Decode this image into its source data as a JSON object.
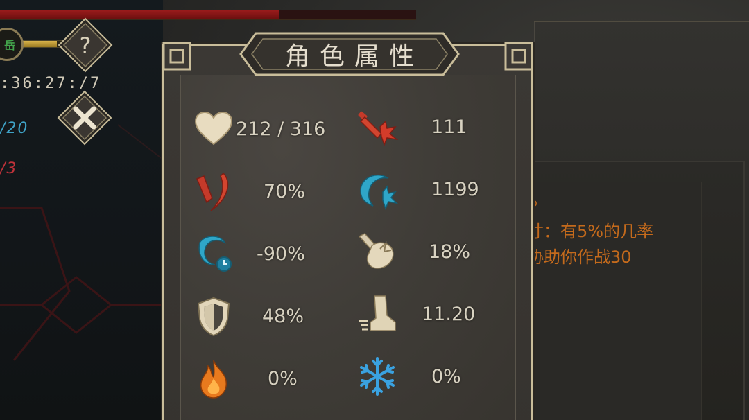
{
  "hud": {
    "hp_fraction": 0.67,
    "xp_fraction": 0.8,
    "level_text": "岳",
    "timer": ":36:27:/7",
    "counter_blue": "/20",
    "counter_red": "/3",
    "help_icon": "question-icon",
    "close_icon": "close-x-icon"
  },
  "panel": {
    "title": "角色属性",
    "stats": [
      {
        "icon": "heart-icon",
        "value": "212 / 316"
      },
      {
        "icon": "attack-icon",
        "value": "111"
      },
      {
        "icon": "crit-chance-icon",
        "value": "70%"
      },
      {
        "icon": "crit-damage-icon",
        "value": "1199"
      },
      {
        "icon": "cooldown-icon",
        "value": "-90%"
      },
      {
        "icon": "lifesteal-icon",
        "value": "18%"
      },
      {
        "icon": "shield-icon",
        "value": "48%"
      },
      {
        "icon": "boot-speed-icon",
        "value": "11.20"
      },
      {
        "icon": "fire-icon",
        "value": "0%"
      },
      {
        "icon": "snowflake-icon",
        "value": "0%"
      }
    ]
  },
  "description": {
    "line_0": "o",
    "line_1": "寸：有5%的几率",
    "line_2": "协助你作战30"
  },
  "colors": {
    "frame": "#c9bd9a",
    "text": "#d8d2c1",
    "desc_text": "#c46a1c",
    "red_icon": "#c43a2a",
    "blue_icon": "#2fa6c8"
  }
}
